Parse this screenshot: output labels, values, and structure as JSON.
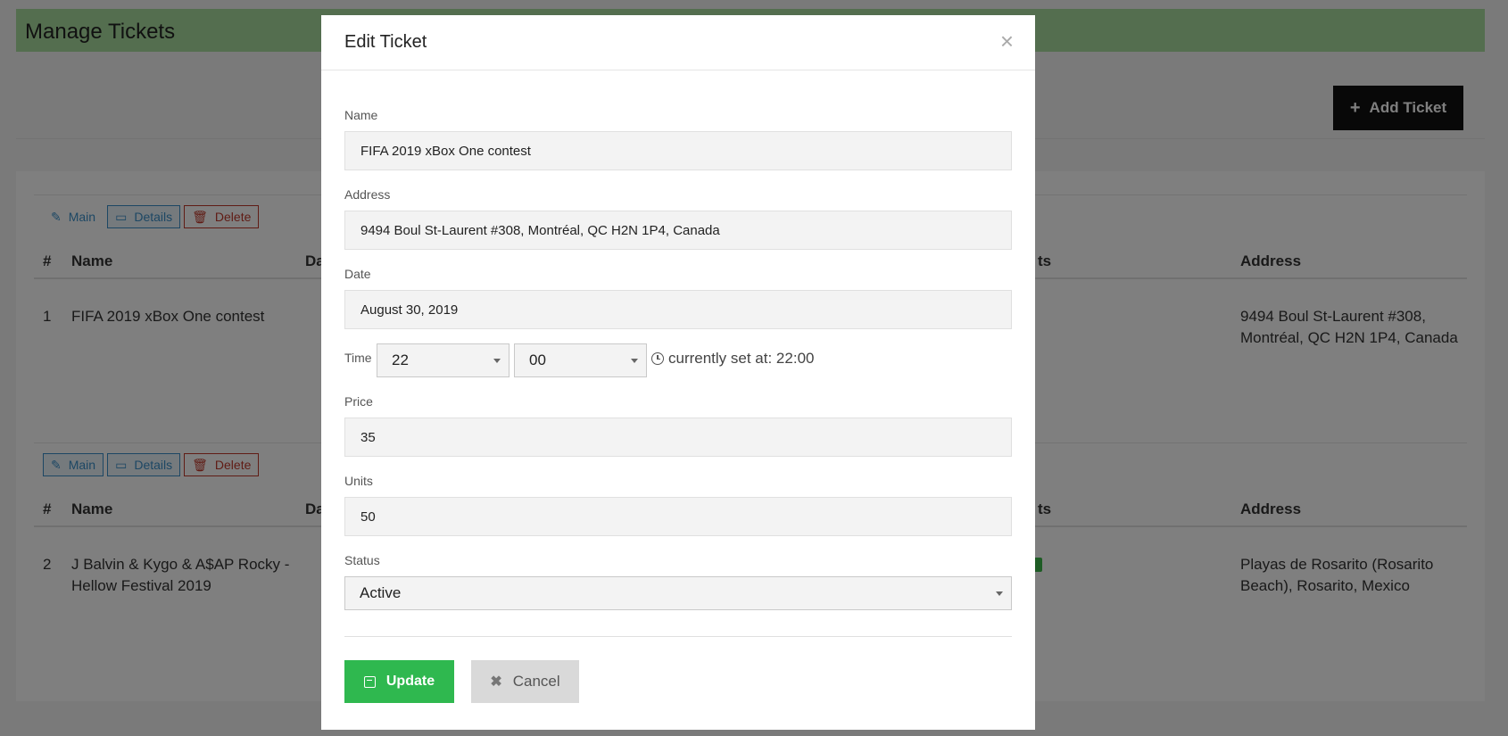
{
  "page": {
    "title": "Manage Tickets",
    "add_button": "Add Ticket"
  },
  "actions": {
    "main": "Main",
    "details": "Details",
    "delete": "Delete"
  },
  "table": {
    "headers": [
      "#",
      "Name",
      "Da",
      "ts",
      "Address"
    ],
    "rows": [
      {
        "num": "1",
        "name": "FIFA 2019 xBox One contest",
        "address_line1": "9494 Boul St-Laurent #308,",
        "address_line2": "Montréal, QC H2N 1P4, Canada"
      },
      {
        "num": "2",
        "name_line1": "J Balvin & Kygo & A$AP Rocky -",
        "name_line2": "Hellow Festival 2019",
        "address_line1": "Playas de Rosarito (Rosarito",
        "address_line2": "Beach), Rosarito, Mexico"
      }
    ]
  },
  "modal": {
    "title": "Edit Ticket",
    "close": "×",
    "fields": {
      "name_label": "Name",
      "name_value": "FIFA 2019 xBox One contest",
      "address_label": "Address",
      "address_value": "9494 Boul St-Laurent #308, Montréal, QC H2N 1P4, Canada",
      "date_label": "Date",
      "date_value": "August 30, 2019",
      "time_label": "Time",
      "hour_value": "22",
      "minute_value": "00",
      "current_time": "currently set at: 22:00",
      "price_label": "Price",
      "price_value": "35",
      "units_label": "Units",
      "units_value": "50",
      "status_label": "Status",
      "status_value": "Active"
    },
    "update_label": "Update",
    "cancel_label": "Cancel"
  },
  "colors": {
    "header_bg": "#a9dd9f",
    "update_bg": "#2fb84f",
    "cancel_bg": "#d9d9d9"
  }
}
